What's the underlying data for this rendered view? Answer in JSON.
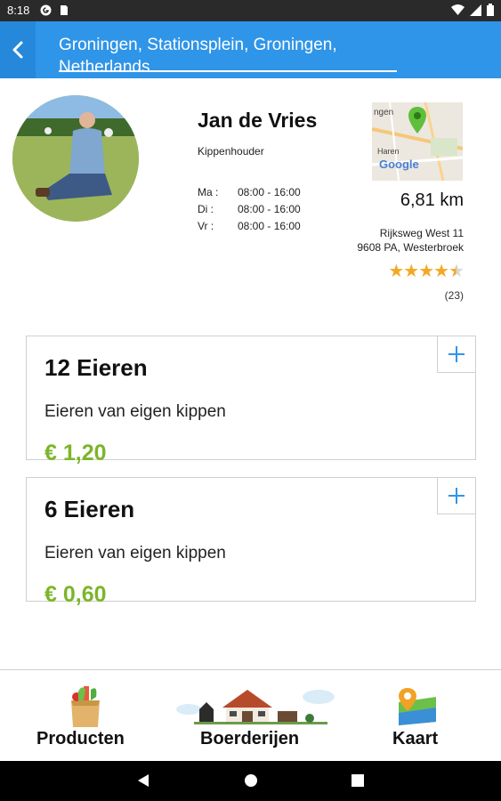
{
  "status_bar": {
    "time": "8:18"
  },
  "app_bar": {
    "title": "Groningen, Stationsplein, Groningen, Netherlands"
  },
  "farmer": {
    "name": "Jan de Vries",
    "role": "Kippenhouder",
    "hours": [
      {
        "day": "Ma :",
        "time": "08:00 - 16:00"
      },
      {
        "day": "Di :",
        "time": "08:00 - 16:00"
      },
      {
        "day": "Vr :",
        "time": "08:00 - 16:00"
      }
    ],
    "map": {
      "label_top": "ngen",
      "label_place": "Haren",
      "brand": "Google"
    },
    "distance": "6,81 km",
    "address_line1": "Rijksweg West 11",
    "address_line2": "9608 PA, Westerbroek",
    "rating": 4.5,
    "stars_text": "★★★★★",
    "reviews": "(23)"
  },
  "products": [
    {
      "title": "12 Eieren",
      "description": "Eieren van eigen kippen",
      "price": "€ 1,20"
    },
    {
      "title": "6 Eieren",
      "description": "Eieren van eigen kippen",
      "price": "€ 0,60"
    }
  ],
  "bottom_nav": {
    "products_label": "Producten",
    "farms_label": "Boerderijen",
    "map_label": "Kaart"
  },
  "colors": {
    "app_bar": "#2f95e8",
    "price_green": "#7cb52a",
    "star": "#f3a824",
    "plus_icon": "#2f95e8"
  }
}
